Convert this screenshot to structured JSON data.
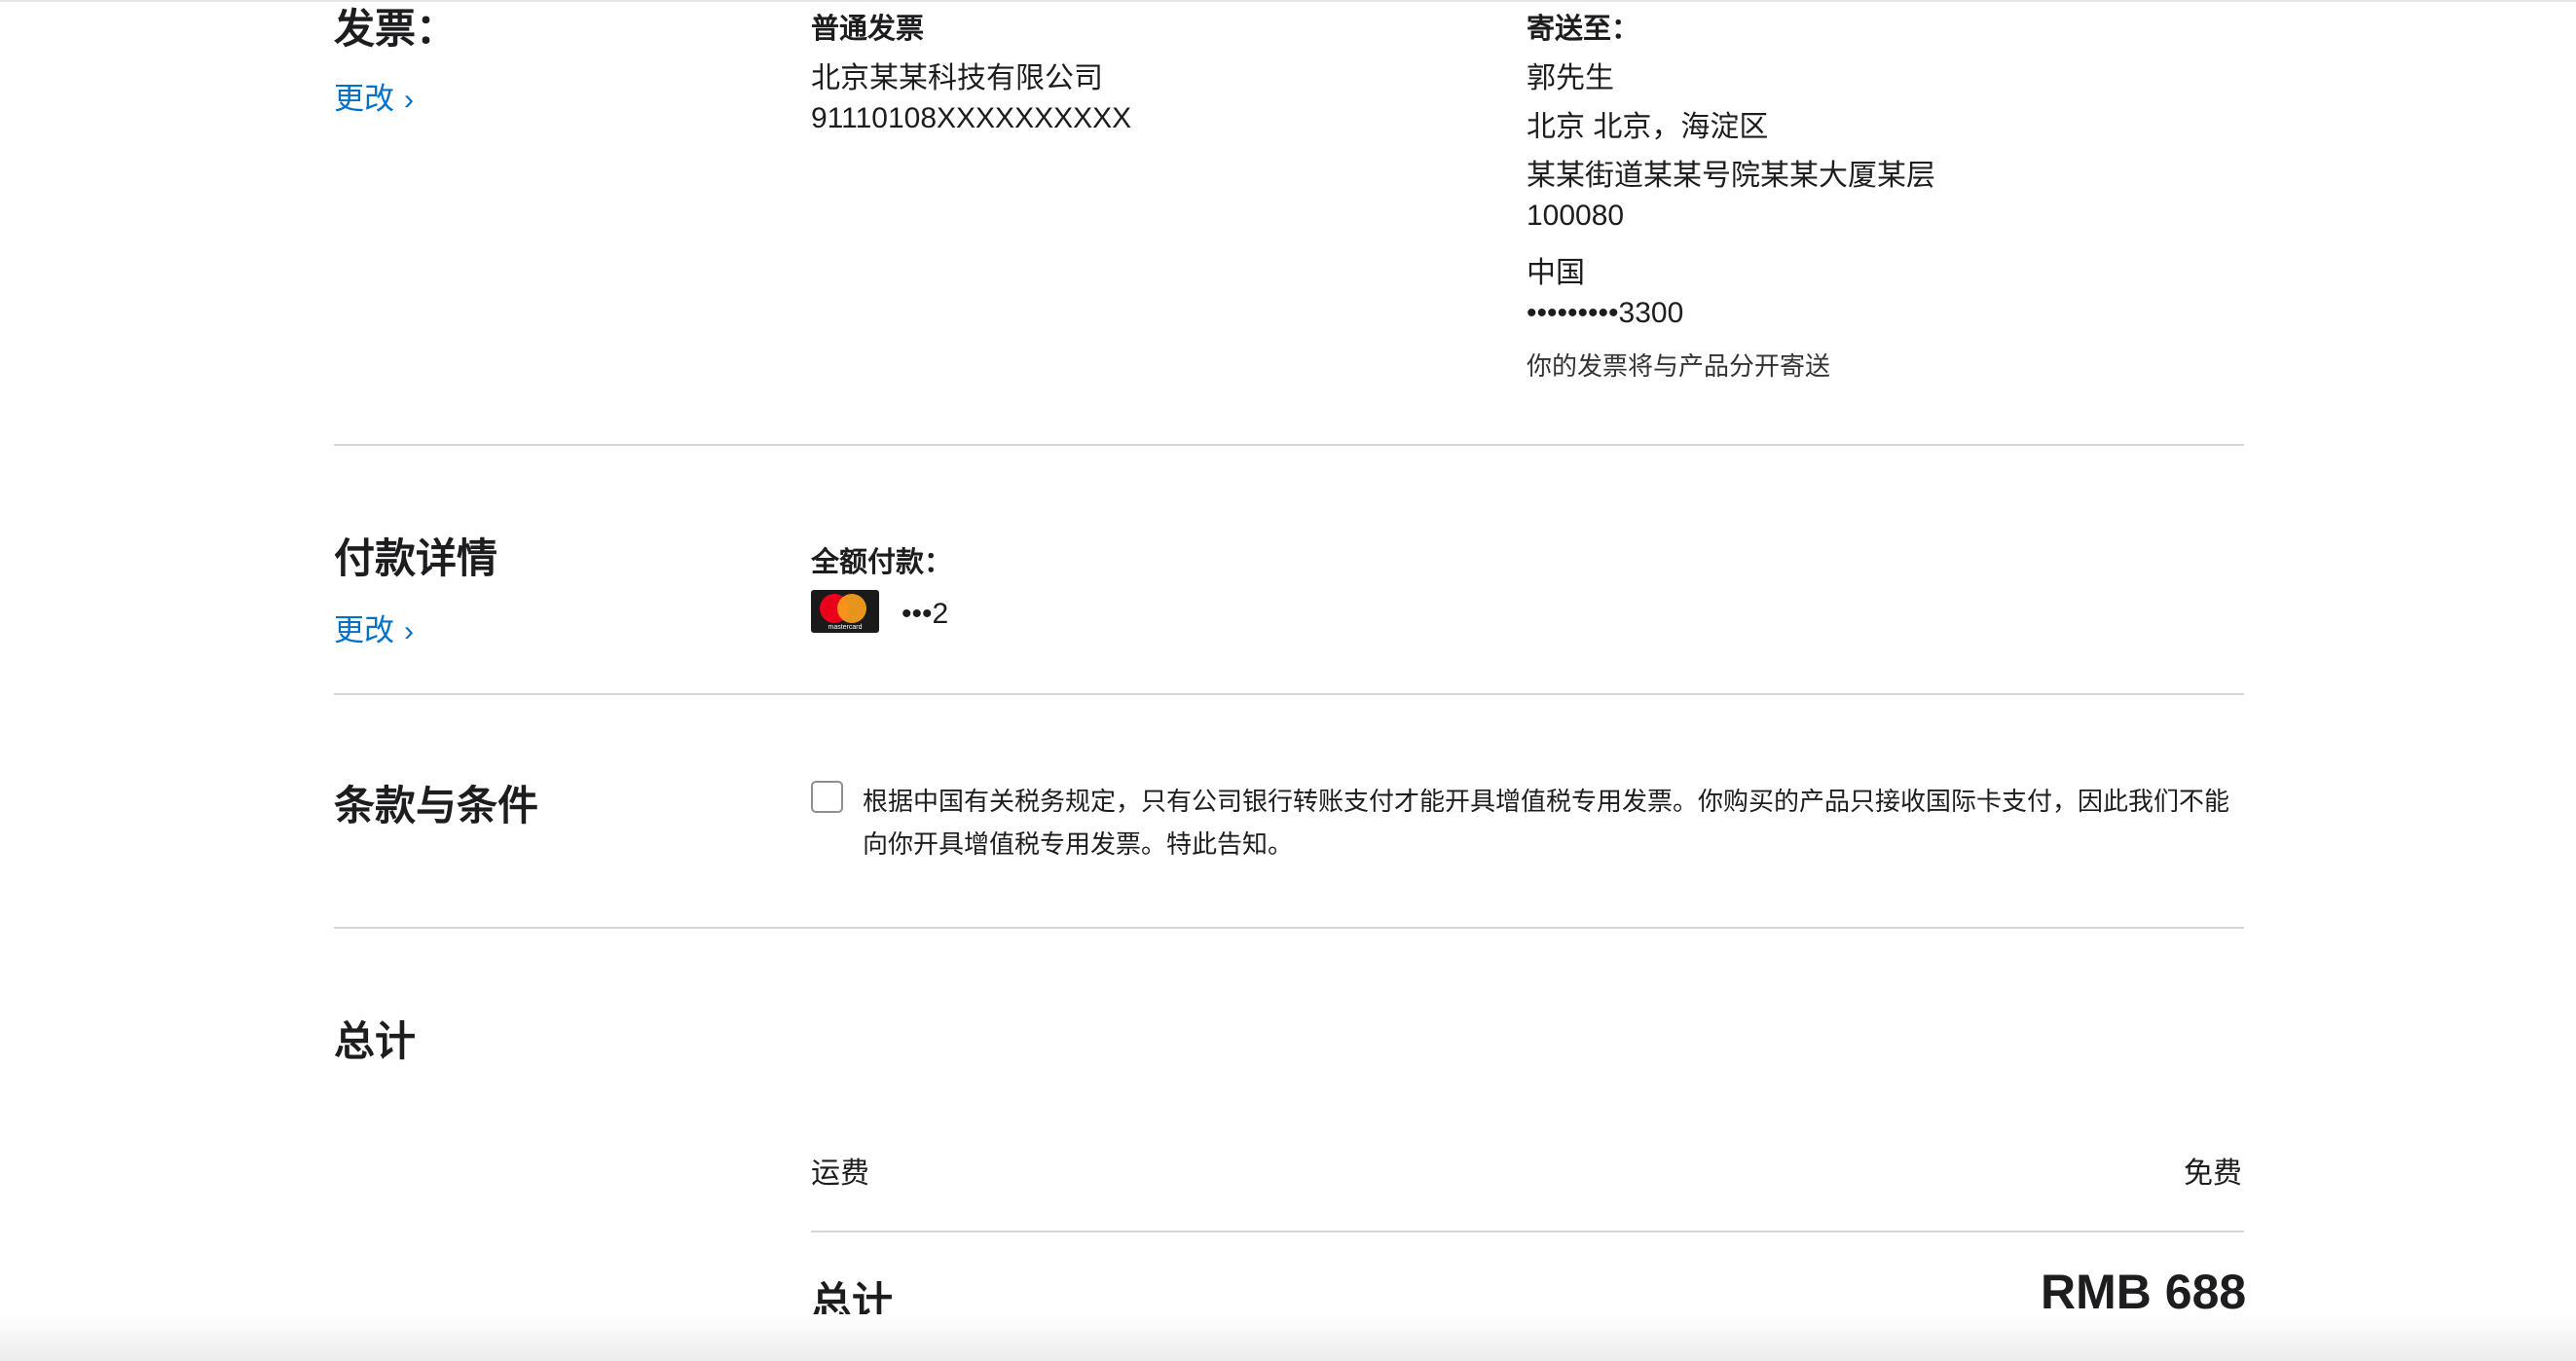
{
  "invoice_section": {
    "title": "发票：",
    "change_label": "更改",
    "invoice_type": "普通发票",
    "company_name": "北京某某科技有限公司",
    "tax_id": "91110108XXXXXXXXXX",
    "ship_to_label": "寄送至：",
    "recipient_name": "郭先生",
    "city_line": "北京 北京，海淀区",
    "street_line": "某某街道某某号院某某大厦某层",
    "postal_code": "100080",
    "country": "中国",
    "phone": "•••••••••3300",
    "note": "你的发票将与产品分开寄送"
  },
  "payment_section": {
    "title": "付款详情",
    "change_label": "更改",
    "full_payment_label": "全额付款：",
    "card_masked": "•••2",
    "card_brand_text": "mastercard"
  },
  "terms_section": {
    "title": "条款与条件",
    "text": "根据中国有关税务规定，只有公司银行转账支付才能开具增值税专用发票。你购买的产品只接收国际卡支付，因此我们不能向你开具增值税专用发票。特此告知。"
  },
  "totals_section": {
    "title": "总计",
    "shipping_label": "运费",
    "shipping_value": "免费",
    "total_label": "总计",
    "total_value": "RMB 688"
  },
  "colors": {
    "link": "#0070c9",
    "text": "#1d1d1f",
    "divider": "#d6d6d6"
  }
}
